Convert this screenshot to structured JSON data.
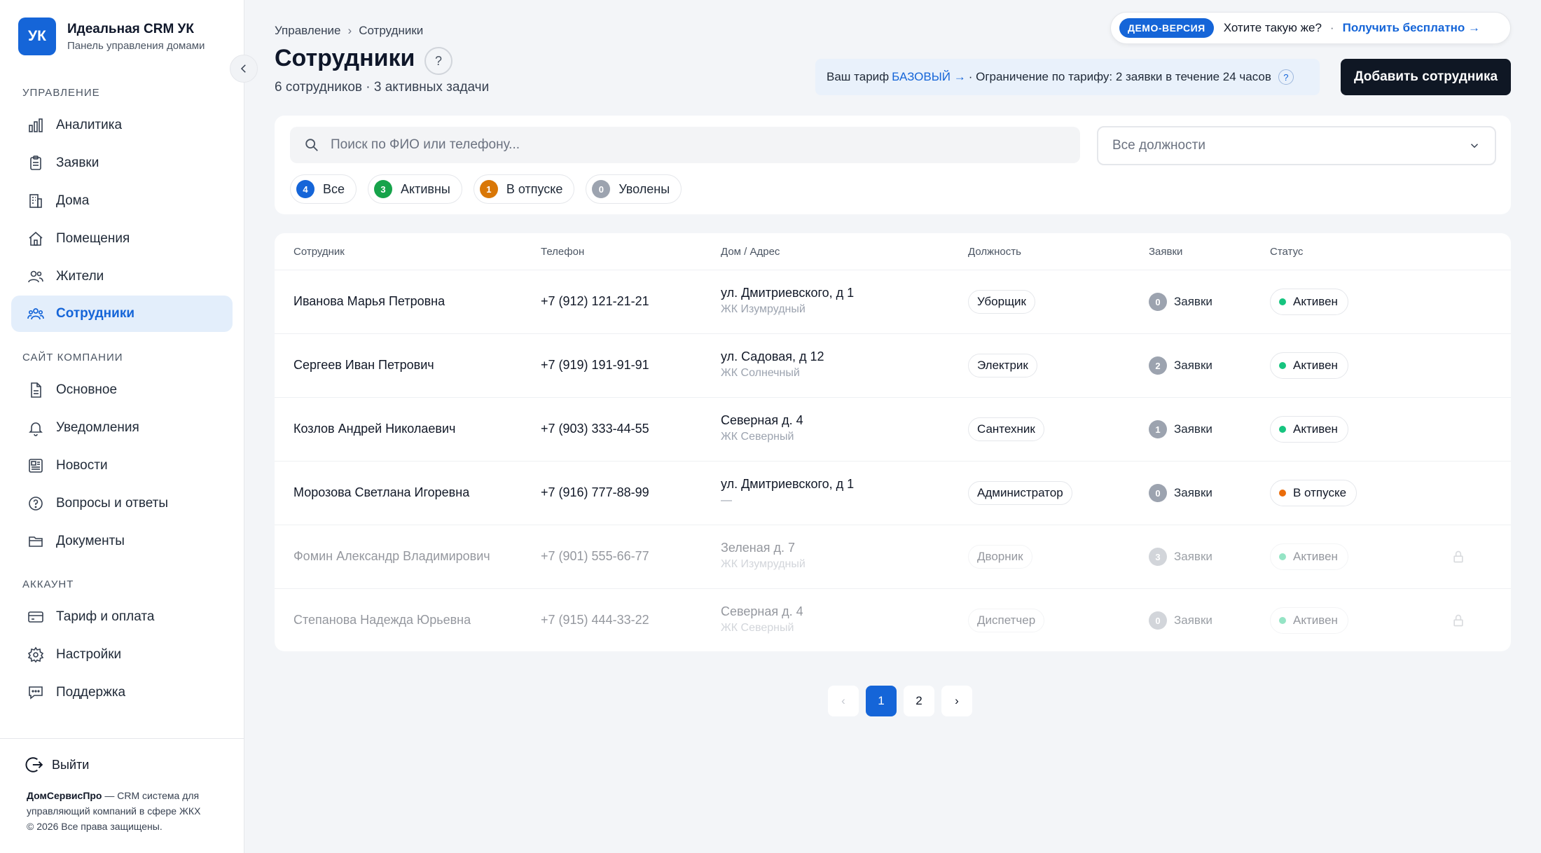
{
  "brand": {
    "logo": "УК",
    "name": "Идеальная CRM УК",
    "subtitle": "Панель управления домами"
  },
  "sidebar": {
    "sections": [
      {
        "title": "УПРАВЛЕНИЕ",
        "items": [
          {
            "label": "Аналитика",
            "icon": "chart-icon"
          },
          {
            "label": "Заявки",
            "icon": "clipboard-icon"
          },
          {
            "label": "Дома",
            "icon": "building-icon"
          },
          {
            "label": "Помещения",
            "icon": "home-icon"
          },
          {
            "label": "Жители",
            "icon": "users-icon"
          },
          {
            "label": "Сотрудники",
            "icon": "team-icon",
            "active": true
          }
        ]
      },
      {
        "title": "САЙТ КОМПАНИИ",
        "items": [
          {
            "label": "Основное",
            "icon": "document-icon"
          },
          {
            "label": "Уведомления",
            "icon": "bell-icon"
          },
          {
            "label": "Новости",
            "icon": "news-icon"
          },
          {
            "label": "Вопросы и ответы",
            "icon": "question-icon"
          },
          {
            "label": "Документы",
            "icon": "folder-icon"
          }
        ]
      },
      {
        "title": "АККАУНТ",
        "items": [
          {
            "label": "Тариф и оплата",
            "icon": "card-icon"
          },
          {
            "label": "Настройки",
            "icon": "gear-icon"
          },
          {
            "label": "Поддержка",
            "icon": "chat-icon"
          }
        ]
      }
    ],
    "logout": "Выйти",
    "footer_brand": "ДомСервисПро",
    "footer_text": " — CRM система для управляющий компаний в сфере ЖКХ",
    "footer_copy": "© 2026 Все права защищены."
  },
  "breadcrumb": {
    "parent": "Управление",
    "sep": "›",
    "current": "Сотрудники"
  },
  "page": {
    "title": "Сотрудники",
    "help": "?",
    "subtitle": "6 сотрудников · 3 активных задачи"
  },
  "demo": {
    "badge": "ДЕМО-ВЕРСИЯ",
    "question": "Хотите такую же?",
    "dot": "·",
    "link": "Получить бесплатно →"
  },
  "tariff": {
    "prefix": "Ваш тариф",
    "plan": "БАЗОВЫЙ →",
    "limit": "· Ограничение по тарифу: 2 заявки в течение 24 часов",
    "help": "?"
  },
  "add_button": "Добавить сотрудника",
  "search": {
    "placeholder": "Поиск по ФИО или телефону..."
  },
  "position_select": {
    "value": "Все должности"
  },
  "chips": [
    {
      "count": "4",
      "label": "Все",
      "color": "#1565d8"
    },
    {
      "count": "3",
      "label": "Активны",
      "color": "#16a34a"
    },
    {
      "count": "1",
      "label": "В отпуске",
      "color": "#d97706"
    },
    {
      "count": "0",
      "label": "Уволены",
      "color": "#9ca3af"
    }
  ],
  "table": {
    "columns": [
      "Сотрудник",
      "Телефон",
      "Дом / Адрес",
      "Должность",
      "Заявки",
      "Статус"
    ],
    "requests_label": "Заявки",
    "rows": [
      {
        "name": "Иванова Марья Петровна",
        "phone": "+7 (912) 121-21-21",
        "street": "ул. Дмитриевского, д 1",
        "complex": "ЖК Изумрудный",
        "position": "Уборщик",
        "requests": "0",
        "status": "Активен",
        "status_color": "#16c47f",
        "dim": false
      },
      {
        "name": "Сергеев Иван Петрович",
        "phone": "+7 (919) 191-91-91",
        "street": "ул. Садовая, д 12",
        "complex": "ЖК Солнечный",
        "position": "Электрик",
        "requests": "2",
        "status": "Активен",
        "status_color": "#16c47f",
        "dim": false
      },
      {
        "name": "Козлов Андрей Николаевич",
        "phone": "+7 (903) 333-44-55",
        "street": "Северная д. 4",
        "complex": "ЖК Северный",
        "position": "Сантехник",
        "requests": "1",
        "status": "Активен",
        "status_color": "#16c47f",
        "dim": false
      },
      {
        "name": "Морозова Светлана Игоревна",
        "phone": "+7 (916) 777-88-99",
        "street": "ул. Дмитриевского, д 1",
        "complex": "—",
        "position": "Администратор",
        "requests": "0",
        "status": "В отпуске",
        "status_color": "#ea6c0a",
        "dim": false
      },
      {
        "name": "Фомин Александр Владимирович",
        "phone": "+7 (901) 555-66-77",
        "street": "Зеленая д. 7",
        "complex": "ЖК Изумрудный",
        "position": "Дворник",
        "requests": "3",
        "status": "Активен",
        "status_color": "#16c47f",
        "dim": true
      },
      {
        "name": "Степанова Надежда Юрьевна",
        "phone": "+7 (915) 444-33-22",
        "street": "Северная д. 4",
        "complex": "ЖК Северный",
        "position": "Диспетчер",
        "requests": "0",
        "status": "Активен",
        "status_color": "#16c47f",
        "dim": true
      }
    ]
  },
  "pagination": {
    "prev": "‹",
    "pages": [
      "1",
      "2"
    ],
    "current": "1",
    "next": "›"
  }
}
